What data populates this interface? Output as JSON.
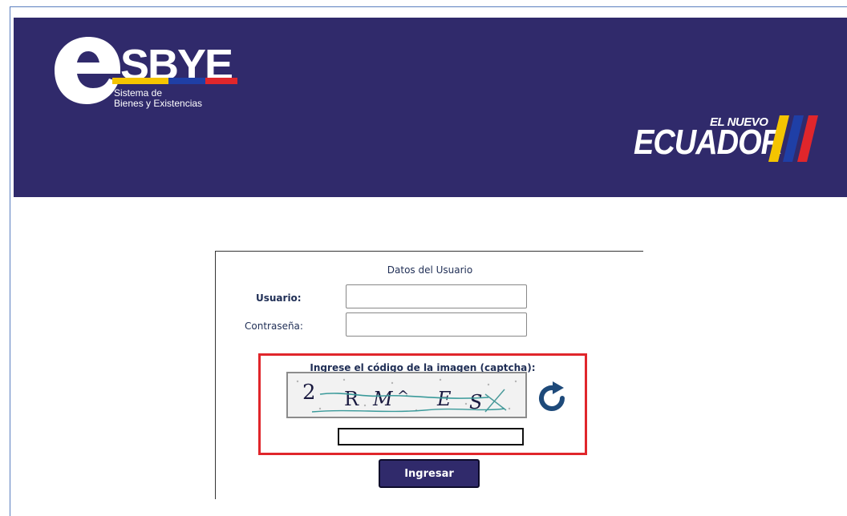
{
  "header": {
    "brand": "SBYE",
    "brand_subtitle_line1": "Sistema de",
    "brand_subtitle_line2": "Bienes y Existencias",
    "gov_small": "EL NUEVO",
    "gov_big": "ECUADOR",
    "colors": {
      "background": "#302a6b",
      "yellow": "#f4c400",
      "blue": "#1f3fa6",
      "red": "#e0262b"
    }
  },
  "login": {
    "title": "Datos del Usuario",
    "usuario_label": "Usuario:",
    "usuario_value": "",
    "password_label": "Contraseña:",
    "password_value": "",
    "captcha_label": "Ingrese el código de la imagen (captcha):",
    "captcha_text": "2 R M E S X",
    "captcha_input_value": "",
    "refresh_icon": "refresh-icon",
    "submit_label": "Ingresar"
  }
}
